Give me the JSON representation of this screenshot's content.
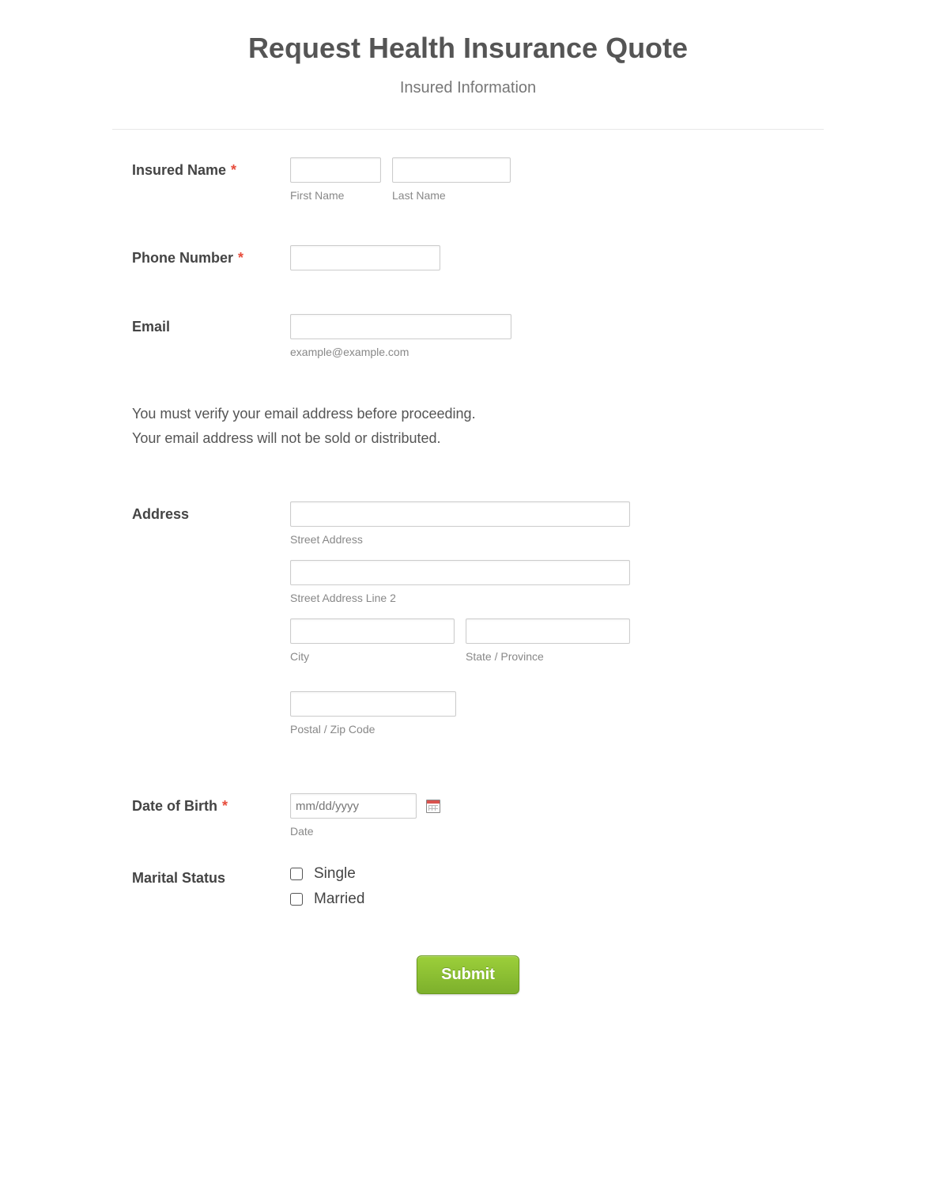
{
  "header": {
    "title": "Request Health Insurance Quote",
    "subtitle": "Insured Information"
  },
  "fields": {
    "insuredName": {
      "label": "Insured Name",
      "required": "*",
      "first": {
        "value": "",
        "sublabel": "First Name"
      },
      "last": {
        "value": "",
        "sublabel": "Last Name"
      }
    },
    "phone": {
      "label": "Phone Number",
      "required": "*",
      "value": ""
    },
    "email": {
      "label": "Email",
      "value": "",
      "sublabel": "example@example.com"
    },
    "note": {
      "line1": "You must verify your email address before proceeding.",
      "line2": "Your email address will not be sold or distributed."
    },
    "address": {
      "label": "Address",
      "street": {
        "value": "",
        "sublabel": "Street Address"
      },
      "street2": {
        "value": "",
        "sublabel": "Street Address Line 2"
      },
      "city": {
        "value": "",
        "sublabel": "City"
      },
      "state": {
        "value": "",
        "sublabel": "State / Province"
      },
      "postal": {
        "value": "",
        "sublabel": "Postal / Zip Code"
      }
    },
    "dob": {
      "label": "Date of Birth",
      "required": "*",
      "placeholder": "mm/dd/yyyy",
      "value": "",
      "sublabel": "Date"
    },
    "marital": {
      "label": "Marital Status",
      "options": [
        "Single",
        "Married"
      ]
    }
  },
  "submit": {
    "label": "Submit"
  }
}
